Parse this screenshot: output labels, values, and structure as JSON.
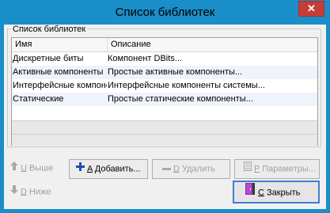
{
  "window": {
    "title": "Список библиотек",
    "close_glyph": "✕"
  },
  "group": {
    "label": "Список библиотек"
  },
  "table": {
    "columns": [
      "Имя",
      "Описание"
    ],
    "rows": [
      {
        "name": "Дискретные биты",
        "desc": "Компонент DBits..."
      },
      {
        "name": "Активные компоненты",
        "desc": "Простые активные компоненты..."
      },
      {
        "name": "Интерфейсные компоненты",
        "desc": "Интерфейсные компоненты системы..."
      },
      {
        "name": "Статические",
        "desc": "Простые статические компоненты..."
      }
    ]
  },
  "buttons": {
    "up": {
      "key": "U",
      "label": " Выше"
    },
    "down": {
      "key": "D",
      "label": " Ниже"
    },
    "add": {
      "key": "A",
      "label": " Добавить..."
    },
    "delete": {
      "key": "D",
      "label": " Удалить"
    },
    "params": {
      "key": "P",
      "label": " Параметры..."
    },
    "close": {
      "key": "C",
      "label": " Закрыть"
    }
  },
  "colors": {
    "titlebar": "#1a8ec8",
    "close_button": "#c53d38",
    "add_icon": "#1c4fb0",
    "default_border": "#3c7fd1"
  }
}
